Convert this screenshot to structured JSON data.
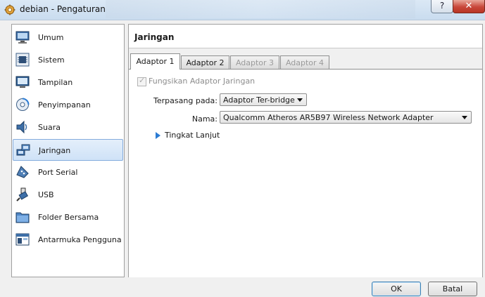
{
  "window": {
    "title": "debian  - Pengaturan",
    "help_symbol": "?",
    "close_symbol": "✕"
  },
  "sidebar": {
    "items": [
      {
        "label": "Umum",
        "icon": "monitor-icon"
      },
      {
        "label": "Sistem",
        "icon": "chip-icon"
      },
      {
        "label": "Tampilan",
        "icon": "display-icon"
      },
      {
        "label": "Penyimpanan",
        "icon": "storage-icon"
      },
      {
        "label": "Suara",
        "icon": "speaker-icon"
      },
      {
        "label": "Jaringan",
        "icon": "network-icon",
        "selected": true
      },
      {
        "label": "Port Serial",
        "icon": "serial-port-icon"
      },
      {
        "label": "USB",
        "icon": "usb-icon"
      },
      {
        "label": "Folder Bersama",
        "icon": "folder-icon"
      },
      {
        "label": "Antarmuka Pengguna",
        "icon": "ui-window-icon"
      }
    ]
  },
  "main": {
    "title": "Jaringan",
    "tabs": [
      {
        "label": "Adaptor 1",
        "active": true
      },
      {
        "label": "Adaptor 2"
      },
      {
        "label": "Adaptor 3",
        "disabled": true
      },
      {
        "label": "Adaptor 4",
        "disabled": true
      }
    ],
    "enable_adapter": {
      "label": "Fungsikan Adaptor Jaringan",
      "checked": true,
      "disabled": true
    },
    "attached_to": {
      "label": "Terpasang pada:",
      "value": "Adaptor Ter-bridge"
    },
    "name": {
      "label": "Nama:",
      "value": "Qualcomm Atheros AR5B97 Wireless Network Adapter"
    },
    "advanced": {
      "label": "Tingkat Lanjut"
    }
  },
  "footer": {
    "ok_label": "OK",
    "cancel_label": "Batal"
  },
  "colors": {
    "accent": "#2b7bd3",
    "selection": "#cfe2f7",
    "close_button": "#c8473a"
  }
}
